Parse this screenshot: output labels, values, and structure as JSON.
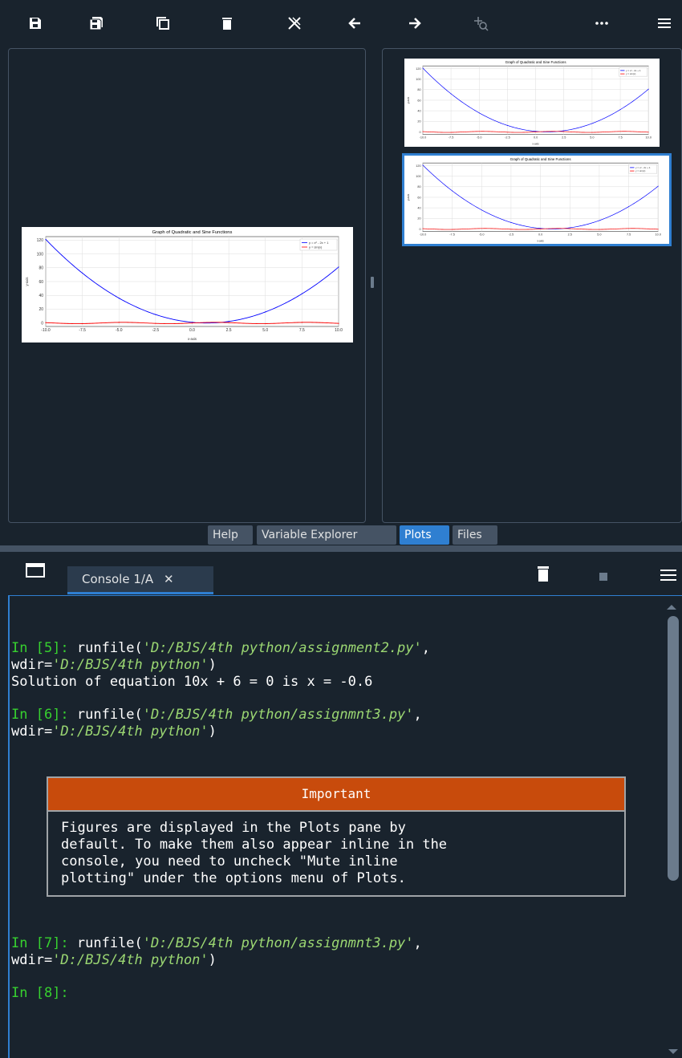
{
  "toolbar": {
    "icons": [
      "save-icon",
      "save-all-icon",
      "copy-icon",
      "trash-icon",
      "close-all-icon",
      "arrow-left-icon",
      "arrow-right-icon",
      "zoom-fit-icon",
      "more-icon",
      "menu-icon"
    ]
  },
  "plot": {
    "title": "Graph of Quadratic and Sine Functions",
    "legend": [
      "y = x² - 2x + 1",
      "y = sin(x)"
    ],
    "xlabel": "x-axis",
    "ylabel": "y-axis",
    "xticks": [
      "-10.0",
      "-7.5",
      "-5.0",
      "-2.5",
      "0.0",
      "2.5",
      "5.0",
      "7.5",
      "10.0"
    ],
    "yticks": [
      "0",
      "20",
      "40",
      "60",
      "80",
      "100",
      "120"
    ],
    "colors": {
      "quad": "#0000ff",
      "sine": "#ff0000"
    }
  },
  "chart_data": {
    "type": "line",
    "title": "Graph of Quadratic and Sine Functions",
    "xlabel": "x-axis",
    "ylabel": "y-axis",
    "xlim": [
      -10,
      10
    ],
    "ylim": [
      -5,
      125
    ],
    "series": [
      {
        "name": "y = x² - 2x + 1",
        "function": "x^2 - 2x + 1",
        "x": [
          -10,
          -7.5,
          -5,
          -2.5,
          0,
          2.5,
          5,
          7.5,
          10
        ],
        "y": [
          121,
          72.25,
          36,
          12.25,
          1,
          2.25,
          16,
          42.25,
          81
        ]
      },
      {
        "name": "y = sin(x)",
        "function": "sin(x)",
        "x": [
          -10,
          -7.5,
          -5,
          -2.5,
          0,
          2.5,
          5,
          7.5,
          10
        ],
        "y": [
          0.54,
          -0.94,
          0.96,
          -0.6,
          0,
          0.6,
          -0.96,
          0.94,
          -0.54
        ]
      }
    ]
  },
  "tabs": [
    {
      "label": "Help",
      "active": false
    },
    {
      "label": "Variable Explorer",
      "active": false
    },
    {
      "label": "Plots",
      "active": true
    },
    {
      "label": "Files",
      "active": false
    }
  ],
  "console": {
    "tab_label": "Console 1/A",
    "close_glyph": "✕",
    "lines": [
      {
        "prompt": "In [5]:",
        "cmd": " runfile(",
        "arg1": "'D:/BJS/4th python/assignment2.py'",
        "tail": ",",
        "wdir": "wdir=",
        "arg2": "'D:/BJS/4th python'",
        "end": ")"
      },
      {
        "output": "Solution of equation 10x + 6 = 0 is x = -0.6"
      },
      {
        "prompt": "In [6]:",
        "cmd": " runfile(",
        "arg1": "'D:/BJS/4th python/assignmnt3.py'",
        "tail": ",",
        "wdir": "wdir=",
        "arg2": "'D:/BJS/4th python'",
        "end": ")"
      },
      {
        "prompt": "In [7]:",
        "cmd": " runfile(",
        "arg1": "'D:/BJS/4th python/assignmnt3.py'",
        "tail": ",",
        "wdir": "wdir=",
        "arg2": "'D:/BJS/4th python'",
        "end": ")"
      },
      {
        "prompt": "In [8]:"
      }
    ],
    "important": {
      "heading": "Important",
      "text": "Figures are displayed in the Plots pane by\ndefault. To make them also appear inline in the\nconsole, you need to uncheck \"Mute inline\nplotting\" under the options menu of Plots."
    }
  }
}
